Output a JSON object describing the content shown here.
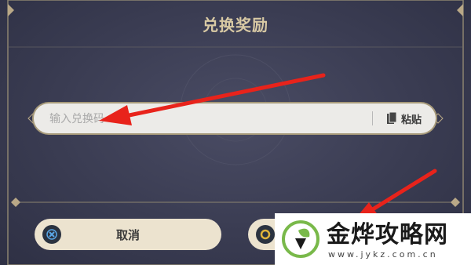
{
  "dialog": {
    "title": "兑换奖励",
    "input_placeholder": "输入兑换码",
    "paste_label": "粘贴",
    "cancel_label": "取消"
  },
  "watermark": {
    "title": "金烨攻略网",
    "url": "www.jykz.com.cn"
  },
  "icons": {
    "paste": "clipboard-icon",
    "cancel": "x-button-icon",
    "confirm": "o-button-icon",
    "logo": "leaf-logo-icon"
  },
  "colors": {
    "accent_gold": "#d8c9a4",
    "button_bg": "#ece3cf",
    "annotation_red": "#e8231b"
  }
}
